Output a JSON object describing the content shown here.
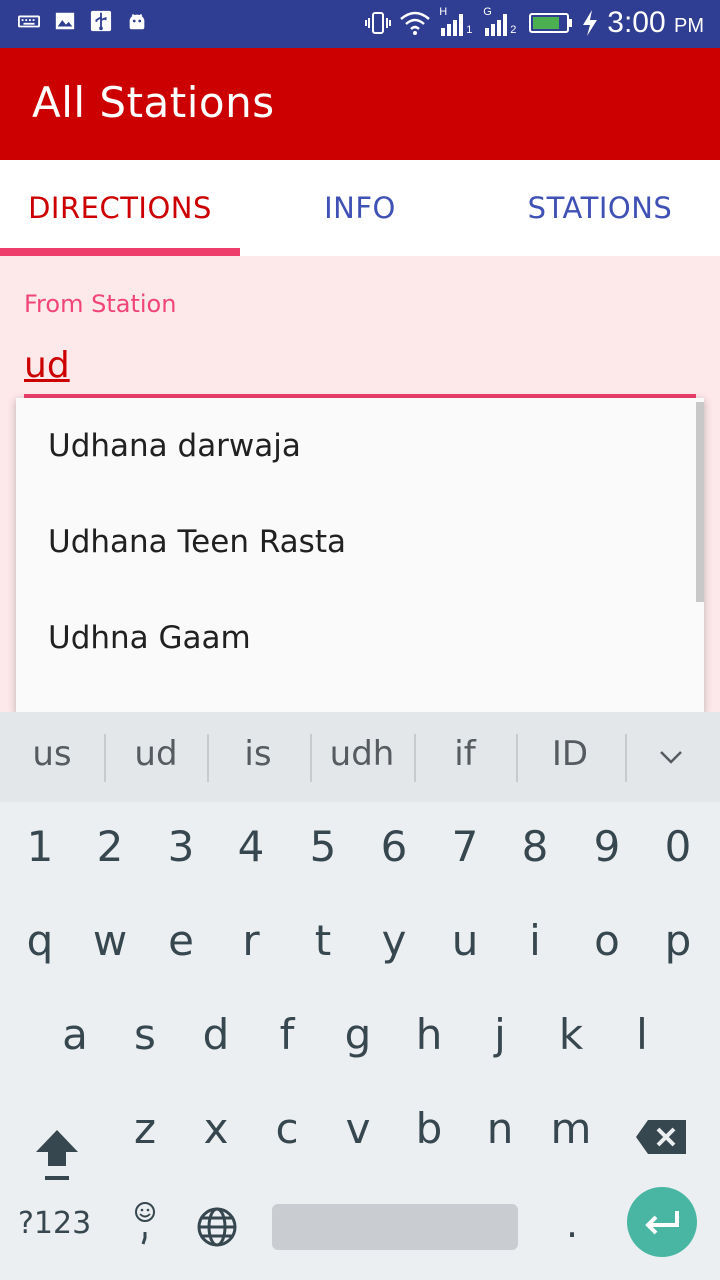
{
  "status_bar": {
    "time": "3:00",
    "ampm": "PM",
    "sim1": "1",
    "sim2": "2",
    "sim1_tech": "H",
    "sim2_tech": "G",
    "icons": [
      "keyboard-icon",
      "image-icon",
      "usb-icon",
      "android-icon",
      "vibrate-icon",
      "wifi-icon",
      "signal-icon",
      "signal-icon",
      "battery-icon",
      "charging-icon"
    ],
    "background": "#2f3d92"
  },
  "app_bar": {
    "title": "All Stations",
    "color": "#cc0000"
  },
  "tabs": [
    {
      "label": "DIRECTIONS",
      "active": true
    },
    {
      "label": "INFO",
      "active": false
    },
    {
      "label": "STATIONS",
      "active": false
    }
  ],
  "colors": {
    "accent": "#ee3f6c",
    "tab_active": "#cc0000",
    "tab_inactive": "#3f51b5",
    "content_bg": "#fde8ea",
    "enter_key": "#49b6a4"
  },
  "from_station": {
    "label": "From Station",
    "value": "ud"
  },
  "suggestions_dropdown": {
    "items": [
      "Udhana darwaja",
      "Udhana Teen Rasta",
      "Udhna Gaam"
    ]
  },
  "keyboard": {
    "suggestions": [
      "us",
      "ud",
      "is",
      "udh",
      "if",
      "ID"
    ],
    "rows": [
      [
        "1",
        "2",
        "3",
        "4",
        "5",
        "6",
        "7",
        "8",
        "9",
        "0"
      ],
      [
        "q",
        "w",
        "e",
        "r",
        "t",
        "y",
        "u",
        "i",
        "o",
        "p"
      ],
      [
        "a",
        "s",
        "d",
        "f",
        "g",
        "h",
        "j",
        "k",
        "l"
      ],
      [
        "z",
        "x",
        "c",
        "v",
        "b",
        "n",
        "m"
      ]
    ],
    "symbols_key": "?123",
    "period_key": ".",
    "icons": [
      "chevron-down-icon",
      "shift-icon",
      "backspace-icon",
      "emoji-icon",
      "globe-icon",
      "enter-icon"
    ]
  }
}
